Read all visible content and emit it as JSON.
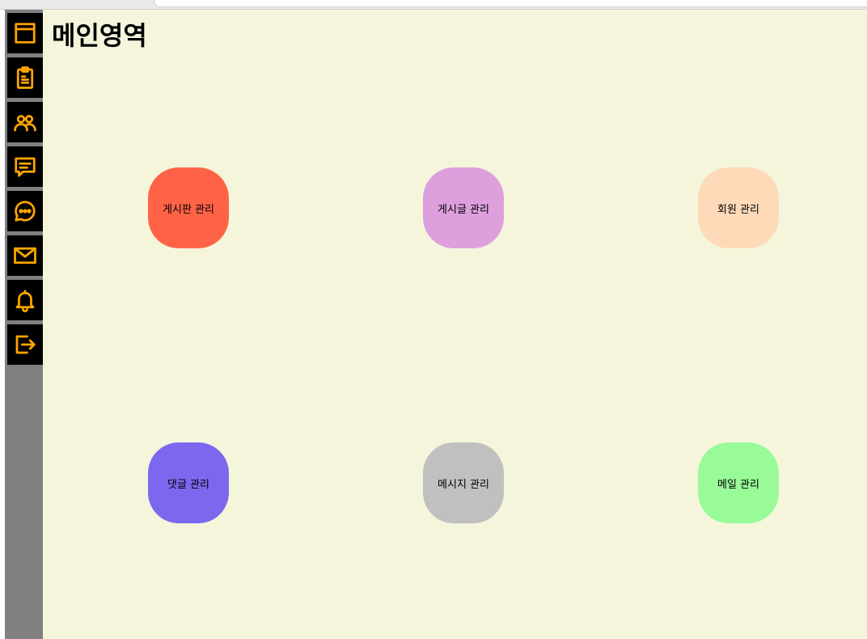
{
  "page": {
    "title": "메인영역"
  },
  "sidebar": {
    "background": "#808080",
    "button_background": "#000000",
    "icon_color": "#ffa500",
    "items": [
      {
        "icon": "layout-icon"
      },
      {
        "icon": "clipboard-icon"
      },
      {
        "icon": "users-icon"
      },
      {
        "icon": "message-square-icon"
      },
      {
        "icon": "chat-bubble-dots-icon"
      },
      {
        "icon": "mail-icon"
      },
      {
        "icon": "bell-icon"
      },
      {
        "icon": "logout-icon"
      }
    ]
  },
  "tiles": [
    {
      "label": "게시판 관리",
      "color": "#ff6347"
    },
    {
      "label": "게시글 관리",
      "color": "#dda0dd"
    },
    {
      "label": "회원 관리",
      "color": "#ffdab9"
    },
    {
      "label": "댓글 관리",
      "color": "#7b68ee"
    },
    {
      "label": "메시지 관리",
      "color": "#c0c0c0"
    },
    {
      "label": "메일 관리",
      "color": "#98fb98"
    }
  ],
  "colors": {
    "main_background": "#f5f5dc"
  }
}
